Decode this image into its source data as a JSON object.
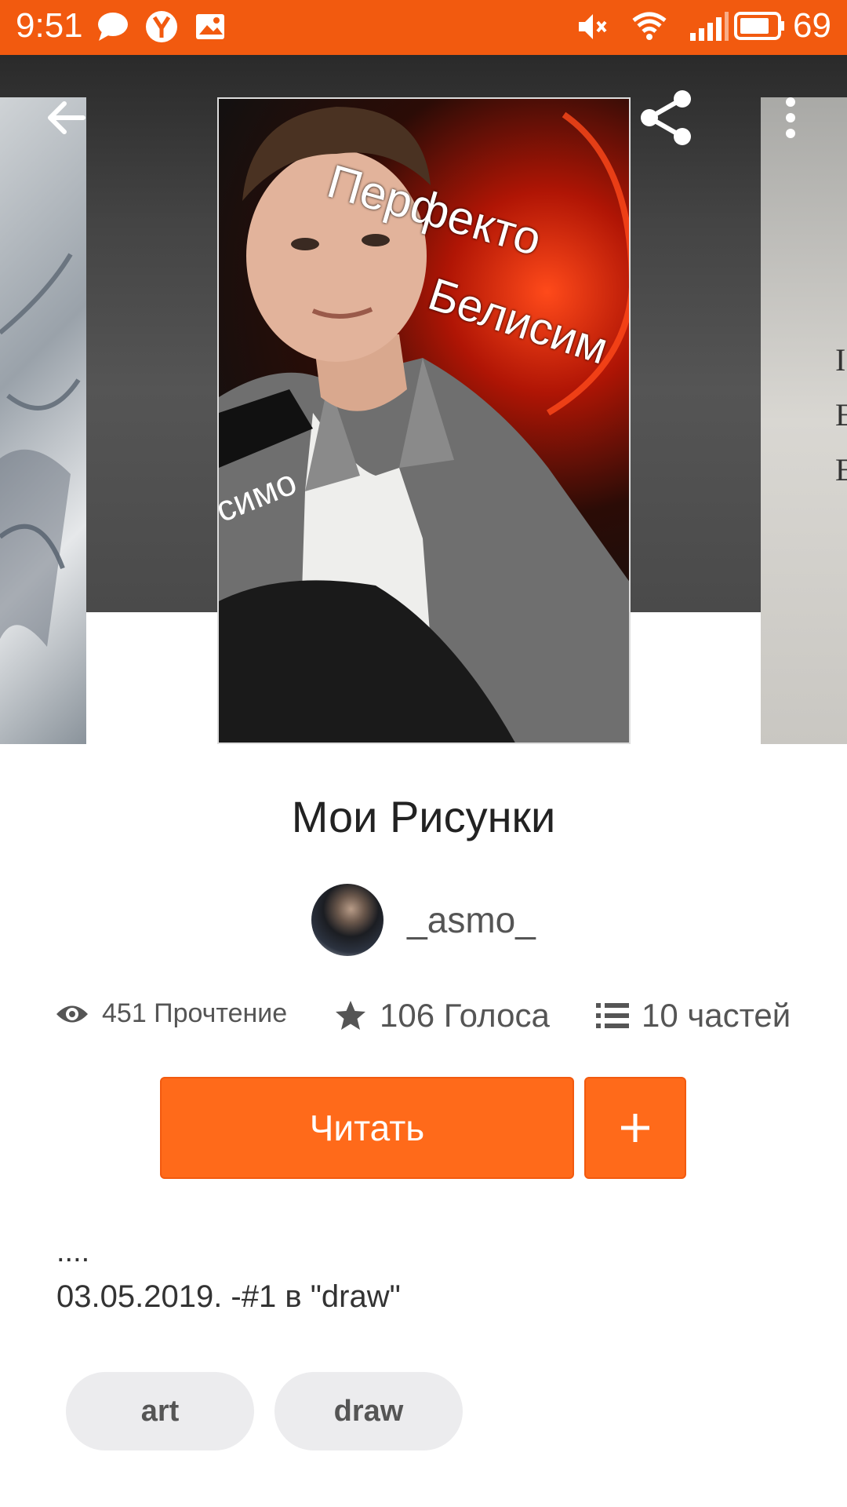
{
  "status_bar": {
    "time": "9:51",
    "battery_level": "69",
    "left_icons": [
      "chat-bubble-icon",
      "yandex-icon",
      "image-notification-icon"
    ],
    "right_icons": [
      "muted-volume-icon",
      "wifi-icon",
      "signal-icon",
      "battery-icon"
    ],
    "color": "#f25a0f"
  },
  "cover": {
    "text_line_1": "Перфекто",
    "text_line_2": "Белисим",
    "text_line_3": "симо"
  },
  "story": {
    "title": "Мои Рисунки",
    "author": "_asmo_"
  },
  "stats": {
    "reads": "451 Прочтение",
    "votes": "106 Голоса",
    "parts": "10 частей"
  },
  "actions": {
    "read_label": "Читать",
    "add_label": "+"
  },
  "description": {
    "dots": "....",
    "line": "03.05.2019. -#1 в \"draw\""
  },
  "tags": [
    "art",
    "draw"
  ],
  "accent_color": "#ff6a1a"
}
